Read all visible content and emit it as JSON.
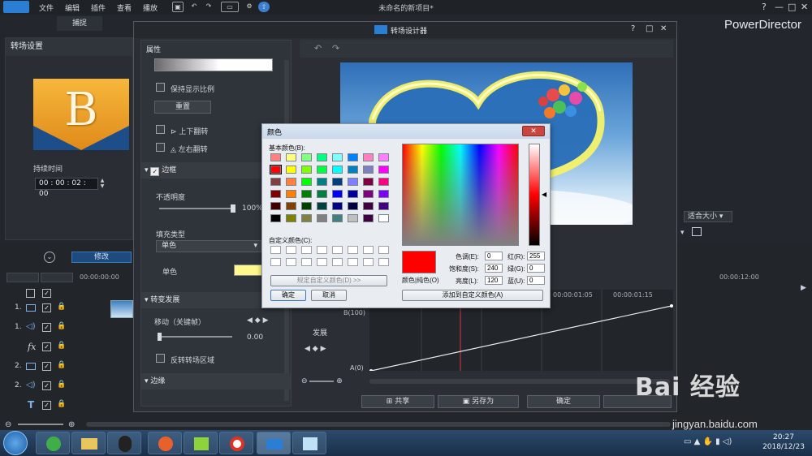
{
  "menubar": {
    "items": [
      "文件",
      "编辑",
      "插件",
      "查看",
      "播放"
    ],
    "title": "未命名的新项目*",
    "window_controls": [
      "?",
      "—",
      "□",
      "✕"
    ]
  },
  "brand": "PowerDirector",
  "capture_tab": "捕捉",
  "left_panel": {
    "title": "转场设置",
    "thumb_letter": "B",
    "duration_label": "持续时间",
    "duration_value": "00 : 00 : 02 : 00",
    "modify_label": "修改"
  },
  "timeline": {
    "timecode_start": "00:00:00:00",
    "tracks": [
      {
        "label": "1.",
        "icon": "video-icon"
      },
      {
        "label": "1.",
        "icon": "audio-icon"
      },
      {
        "label": "fx",
        "icon": "fx-icon"
      },
      {
        "label": "2.",
        "icon": "video-icon"
      },
      {
        "label": "2.",
        "icon": "audio-icon"
      },
      {
        "label": "T",
        "icon": "title-icon"
      }
    ],
    "right_label": "00:00:12:00",
    "ruler_labels": [
      "00:00:01:05",
      "00:00:01:15"
    ],
    "fit_label": "适合大小"
  },
  "designer": {
    "title": "转场设计器",
    "properties_header": "属性",
    "keep_ratio": "保持显示比例",
    "reset": "重置",
    "flip_vertical": "上下翻转",
    "flip_horizontal": "左右翻转",
    "border_section": "边框",
    "opacity_label": "不透明度",
    "opacity_value": "100%",
    "fill_type_label": "填充类型",
    "fill_type_value": "单色",
    "solid_label": "单色",
    "transition_section": "转变发展",
    "move_label": "移动（关键帧）",
    "move_value": "0.00",
    "reverse_label": "反转转场区域",
    "edge_section": "边缘",
    "graph": {
      "b_label": "B(100)",
      "a_label": "A(0)",
      "left_label": "发展"
    },
    "buttons": {
      "share": "共享",
      "save_as": "另存为",
      "ok": "确定"
    }
  },
  "color_dialog": {
    "title": "颜色",
    "basic_colors_label": "基本颜色(B):",
    "custom_colors_label": "自定义颜色(C):",
    "define_custom": "规定自定义颜色(D) >>",
    "ok": "确定",
    "cancel": "取消",
    "color_solid_label": "颜色|纯色(O)",
    "add_custom": "添加到自定义颜色(A)",
    "fields": {
      "hue_label": "色调(E):",
      "hue": "0",
      "sat_label": "饱和度(S):",
      "sat": "240",
      "lum_label": "亮度(L):",
      "lum": "120",
      "red_label": "红(R):",
      "red": "255",
      "green_label": "绿(G):",
      "green": "0",
      "blue_label": "蓝(U):",
      "blue": "0"
    },
    "basic_colors": [
      "#ff8080",
      "#ffff80",
      "#80ff80",
      "#00ff80",
      "#80ffff",
      "#0080ff",
      "#ff80c0",
      "#ff80ff",
      "#ff0000",
      "#ffff00",
      "#80ff00",
      "#00ff40",
      "#00ffff",
      "#0080c0",
      "#8080c0",
      "#ff00ff",
      "#804040",
      "#ff8040",
      "#00ff00",
      "#008080",
      "#004080",
      "#8080ff",
      "#800040",
      "#ff0080",
      "#800000",
      "#ff8000",
      "#008000",
      "#008040",
      "#0000ff",
      "#0000a0",
      "#800080",
      "#8000ff",
      "#400000",
      "#804000",
      "#004000",
      "#004040",
      "#000080",
      "#000040",
      "#400040",
      "#400080",
      "#000000",
      "#808000",
      "#808040",
      "#808080",
      "#408080",
      "#c0c0c0",
      "#400040",
      "#ffffff"
    ]
  },
  "taskbar": {
    "time": "20:27",
    "date": "2018/12/23"
  },
  "watermark": {
    "line1": "Bai 经验",
    "line2": "jingyan.baidu.com"
  }
}
